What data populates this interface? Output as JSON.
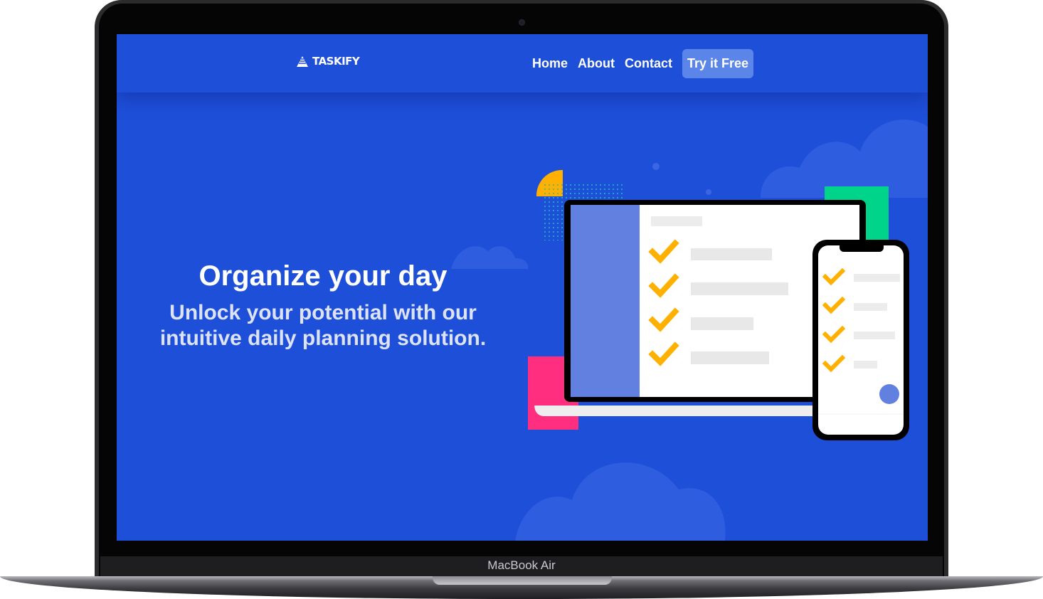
{
  "device": {
    "label": "MacBook Air"
  },
  "navbar": {
    "logo_text": "TASKIFY",
    "links": [
      {
        "label": "Home"
      },
      {
        "label": "About"
      },
      {
        "label": "Contact"
      }
    ],
    "cta_label": "Try it Free"
  },
  "hero": {
    "title": "Organize your day",
    "subtitle": "Unlock your potential with our intuitive daily planning solution."
  },
  "colors": {
    "background": "#1e4fd9",
    "cta": "#5c85ea",
    "checkmark": "#ffb000",
    "accent_pink": "#ff2e7e",
    "accent_green": "#00d38a",
    "accent_yellow": "#ffb000"
  }
}
